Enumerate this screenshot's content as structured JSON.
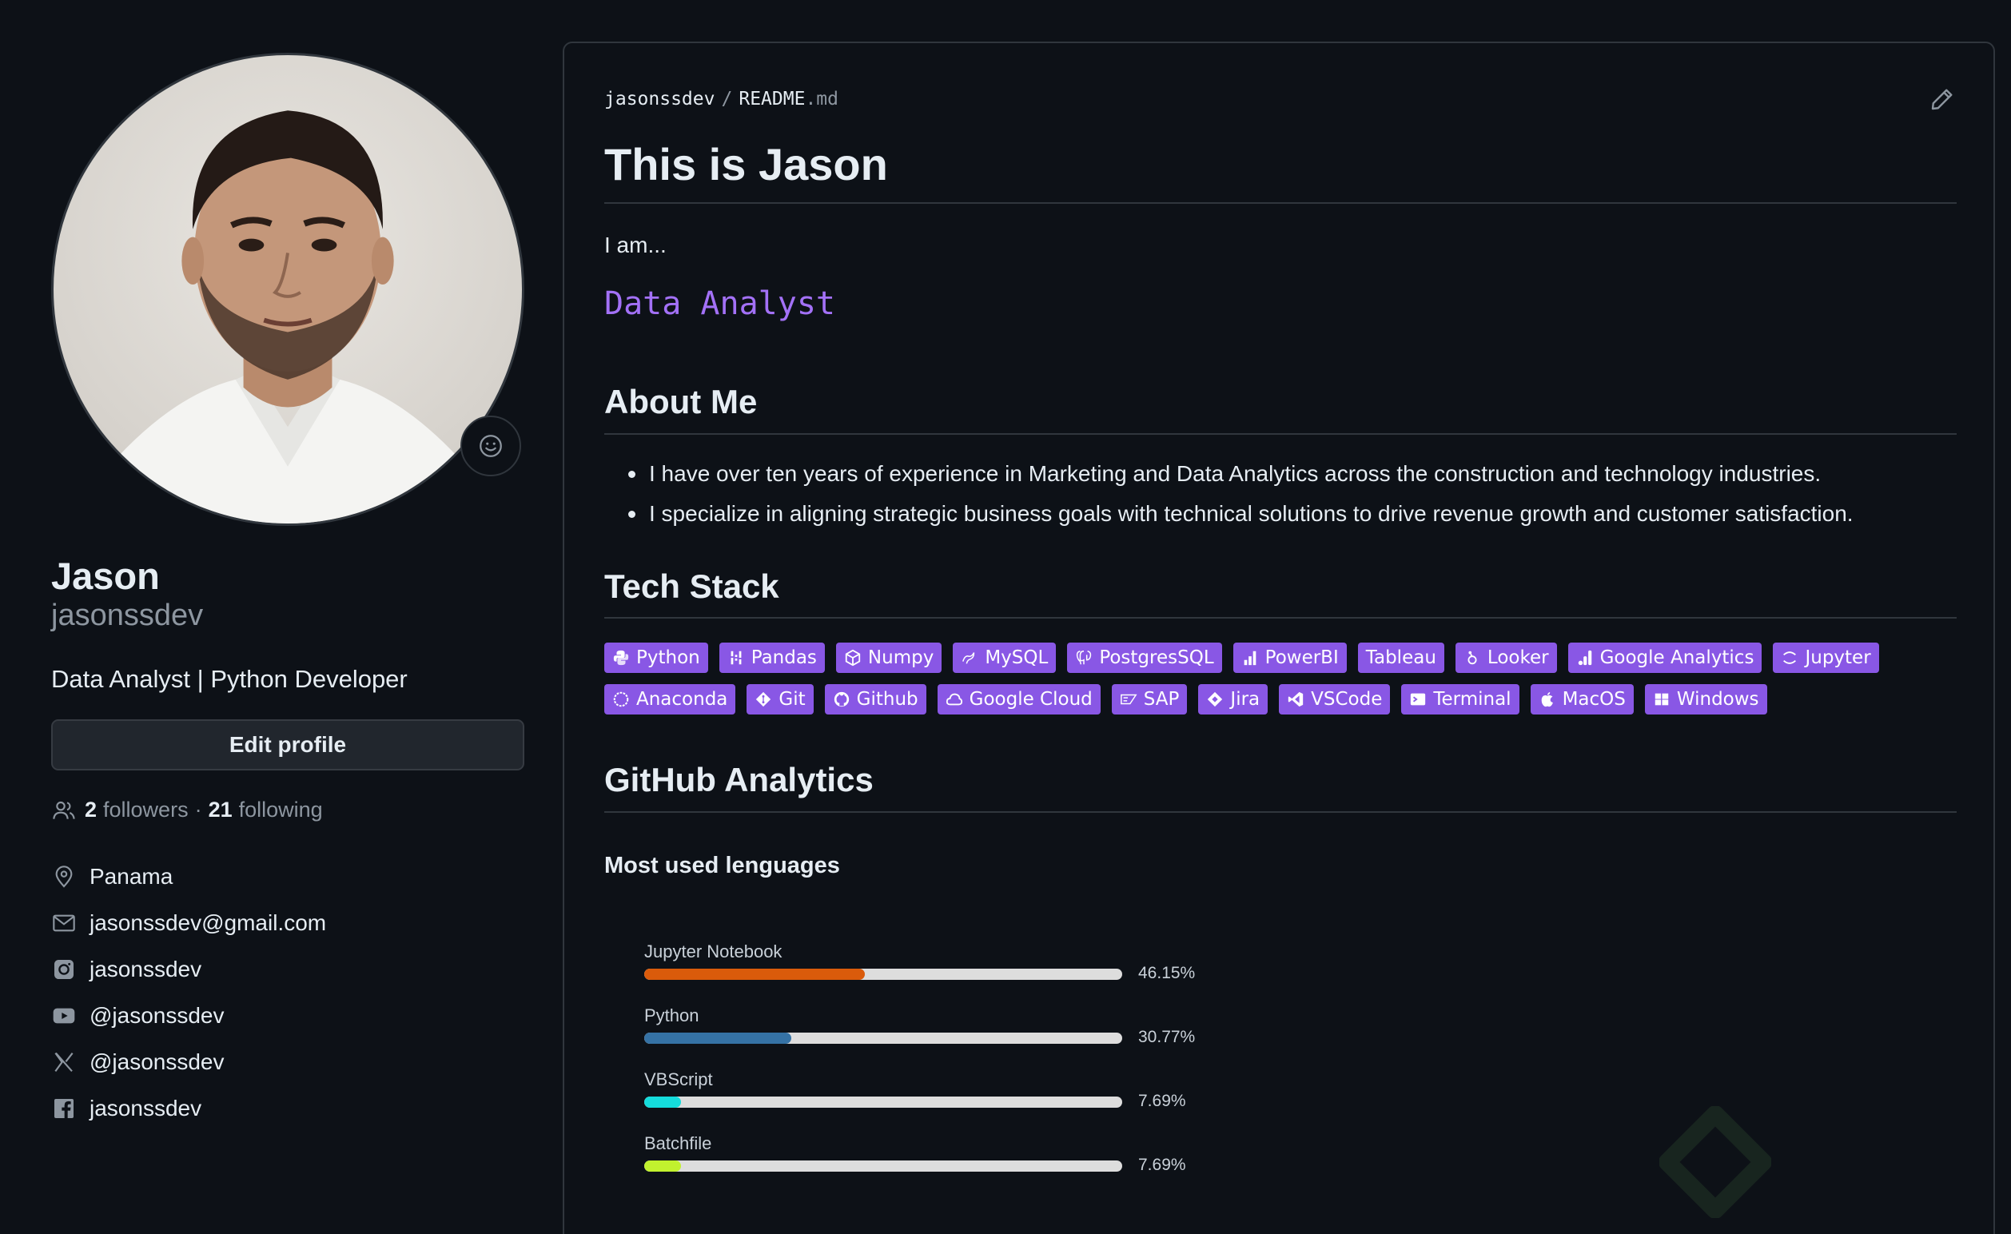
{
  "profile": {
    "name": "Jason",
    "login": "jasonssdev",
    "bio": "Data Analyst | Python Developer",
    "edit_label": "Edit profile",
    "followers_count": "2",
    "followers_label": "followers",
    "separator": "·",
    "following_count": "21",
    "following_label": "following",
    "details": [
      {
        "icon": "location-icon",
        "text": "Panama"
      },
      {
        "icon": "mail-icon",
        "text": "jasonssdev@gmail.com"
      },
      {
        "icon": "instagram-icon",
        "text": "jasonssdev"
      },
      {
        "icon": "youtube-icon",
        "text": "@jasonssdev"
      },
      {
        "icon": "x-icon",
        "text": "@jasonssdev"
      },
      {
        "icon": "facebook-icon",
        "text": "jasonssdev"
      }
    ]
  },
  "readme": {
    "owner": "jasonssdev",
    "slash": "/",
    "file_base": "README",
    "file_ext": ".md",
    "title": "This is Jason",
    "intro": "I am...",
    "typing_text": "Data Analyst",
    "about_heading": "About Me",
    "about_items": [
      "I have over ten years of experience in Marketing and Data Analytics across the construction and technology industries.",
      "I specialize in aligning strategic business goals with technical solutions to drive revenue growth and customer satisfaction."
    ],
    "tech_heading": "Tech Stack",
    "badges": [
      {
        "label": "Python",
        "icon": "python-icon"
      },
      {
        "label": "Pandas",
        "icon": "pandas-icon"
      },
      {
        "label": "Numpy",
        "icon": "numpy-icon"
      },
      {
        "label": "MySQL",
        "icon": "mysql-icon"
      },
      {
        "label": "PostgresSQL",
        "icon": "postgresql-icon"
      },
      {
        "label": "PowerBI",
        "icon": "powerbi-icon"
      },
      {
        "label": "Tableau",
        "icon": ""
      },
      {
        "label": "Looker",
        "icon": "looker-icon"
      },
      {
        "label": "Google Analytics",
        "icon": "google-analytics-icon"
      },
      {
        "label": "Jupyter",
        "icon": "jupyter-icon"
      },
      {
        "label": "Anaconda",
        "icon": "anaconda-icon"
      },
      {
        "label": "Git",
        "icon": "git-icon"
      },
      {
        "label": "Github",
        "icon": "github-icon"
      },
      {
        "label": "Google Cloud",
        "icon": "google-cloud-icon"
      },
      {
        "label": "SAP",
        "icon": "sap-icon"
      },
      {
        "label": "Jira",
        "icon": "jira-icon"
      },
      {
        "label": "VSCode",
        "icon": "vscode-icon"
      },
      {
        "label": "Terminal",
        "icon": "terminal-icon"
      },
      {
        "label": "MacOS",
        "icon": "apple-icon"
      },
      {
        "label": "Windows",
        "icon": "windows-icon"
      }
    ],
    "analytics_heading": "GitHub Analytics",
    "langs_title": "Most used lenguages",
    "languages": [
      {
        "name": "Jupyter Notebook",
        "percent_label": "46.15%",
        "value": 46.15,
        "color": "#DA5B0B"
      },
      {
        "name": "Python",
        "percent_label": "30.77%",
        "value": 30.77,
        "color": "#3572A5"
      },
      {
        "name": "VBScript",
        "percent_label": "7.69%",
        "value": 7.69,
        "color": "#15dcdc"
      },
      {
        "name": "Batchfile",
        "percent_label": "7.69%",
        "value": 7.69,
        "color": "#C1F12E"
      }
    ]
  },
  "colors": {
    "background": "#0d1117",
    "accent_badge": "#8957e5",
    "typing_text": "#a371f7"
  }
}
